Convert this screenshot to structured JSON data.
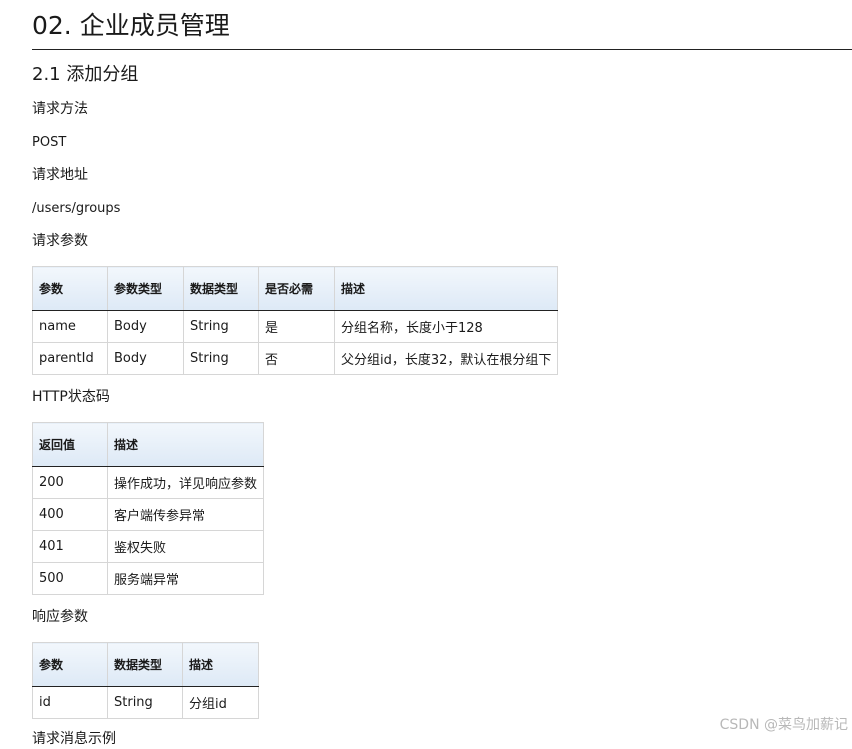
{
  "title": "02. 企业成员管理",
  "section": "2.1 添加分组",
  "request_method_label": "请求方法",
  "request_method": "POST",
  "request_url_label": "请求地址",
  "request_url": "/users/groups",
  "request_params_label": "请求参数",
  "request_params_table": {
    "headers": [
      "参数",
      "参数类型",
      "数据类型",
      "是否必需",
      "描述"
    ],
    "rows": [
      [
        "name",
        "Body",
        "String",
        "是",
        "分组名称，长度小于128"
      ],
      [
        "parentId",
        "Body",
        "String",
        "否",
        "父分组id，长度32，默认在根分组下"
      ]
    ]
  },
  "http_status_label": "HTTP状态码",
  "http_status_table": {
    "headers": [
      "返回值",
      "描述"
    ],
    "rows": [
      [
        "200",
        "操作成功，详见响应参数"
      ],
      [
        "400",
        "客户端传参异常"
      ],
      [
        "401",
        "鉴权失败"
      ],
      [
        "500",
        "服务端异常"
      ]
    ]
  },
  "response_params_label": "响应参数",
  "response_params_table": {
    "headers": [
      "参数",
      "数据类型",
      "描述"
    ],
    "rows": [
      [
        "id",
        "String",
        "分组id"
      ]
    ]
  },
  "next_label": "请求消息示例",
  "watermark": "CSDN @菜鸟加薪记"
}
